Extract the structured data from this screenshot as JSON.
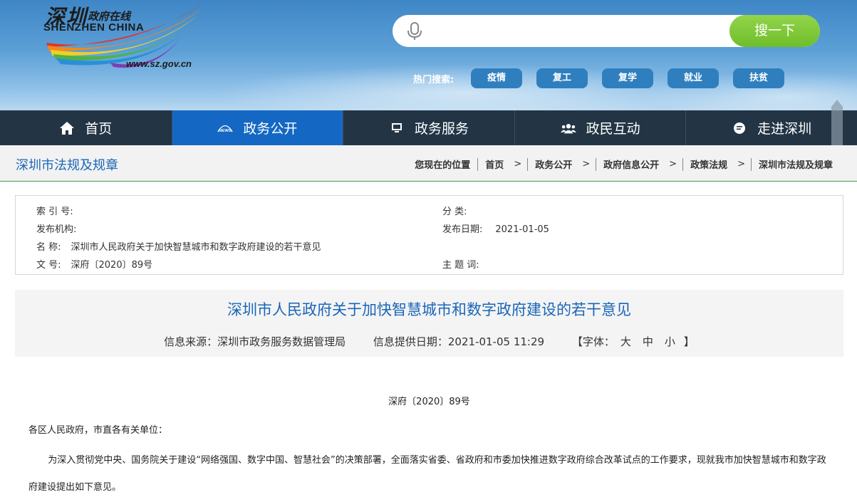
{
  "header": {
    "logo": {
      "title_cn": "深圳",
      "subtitle_cn": "政府在线",
      "title_en": "SHENZHEN CHINA",
      "url": "www.sz.gov.cn"
    },
    "search": {
      "placeholder": "",
      "button_label": "搜一下",
      "mic_icon": "microphone-icon"
    },
    "hot_search": {
      "label": "热门搜索:",
      "tags": [
        "疫情",
        "复工",
        "复学",
        "就业",
        "扶贫"
      ]
    }
  },
  "nav": {
    "items": [
      {
        "label": "首页",
        "icon": "home-icon",
        "active": false
      },
      {
        "label": "政务公开",
        "icon": "news-icon",
        "active": true
      },
      {
        "label": "政务服务",
        "icon": "monitor-icon",
        "active": false
      },
      {
        "label": "政民互动",
        "icon": "users-icon",
        "active": false
      },
      {
        "label": "走进深圳",
        "icon": "chat-icon",
        "active": false
      }
    ]
  },
  "breadcrumb": {
    "section_title": "深圳市法规及规章",
    "location_label": "您现在的位置",
    "items": [
      "首页",
      "政务公开",
      "政府信息公开",
      "政策法规",
      "深圳市法规及规章"
    ],
    "separator": ">"
  },
  "meta": {
    "index_label": "索 引 号:",
    "index_value": "",
    "category_label": "分 类:",
    "category_value": "",
    "publisher_label": "发布机构:",
    "publisher_value": "",
    "date_label": "发布日期:",
    "date_value": "2021-01-05",
    "name_label": "名 称:",
    "name_value": "深圳市人民政府关于加快智慧城市和数字政府建设的若干意见",
    "docno_label": "文 号:",
    "docno_value": "深府〔2020〕89号",
    "keywords_label": "主 题 词:",
    "keywords_value": ""
  },
  "article": {
    "title": "深圳市人民政府关于加快智慧城市和数字政府建设的若干意见",
    "source": "信息来源：深圳市政务服务数据管理局",
    "provided_date": "信息提供日期：2021-01-05 11:29",
    "font_label_open": "【字体：",
    "font_sizes": [
      "大",
      "中",
      "小"
    ],
    "font_label_close": "】",
    "doc_number": "深府〔2020〕89号",
    "greeting": "各区人民政府，市直各有关单位：",
    "paragraph": "为深入贯彻党中央、国务院关于建设“网络强国、数字中国、智慧社会”的决策部署，全面落实省委、省政府和市委加快推进数字政府综合改革试点的工作要求，现就我市加快智慧城市和数字政府建设提出如下意见。"
  },
  "colors": {
    "nav_bg": "#233545",
    "nav_active": "#1468c4",
    "link_blue": "#1a66b8",
    "search_button": "#7cc535",
    "hot_tag": "#2f7fbf",
    "breadcrumb_border": "#3ba34a"
  }
}
